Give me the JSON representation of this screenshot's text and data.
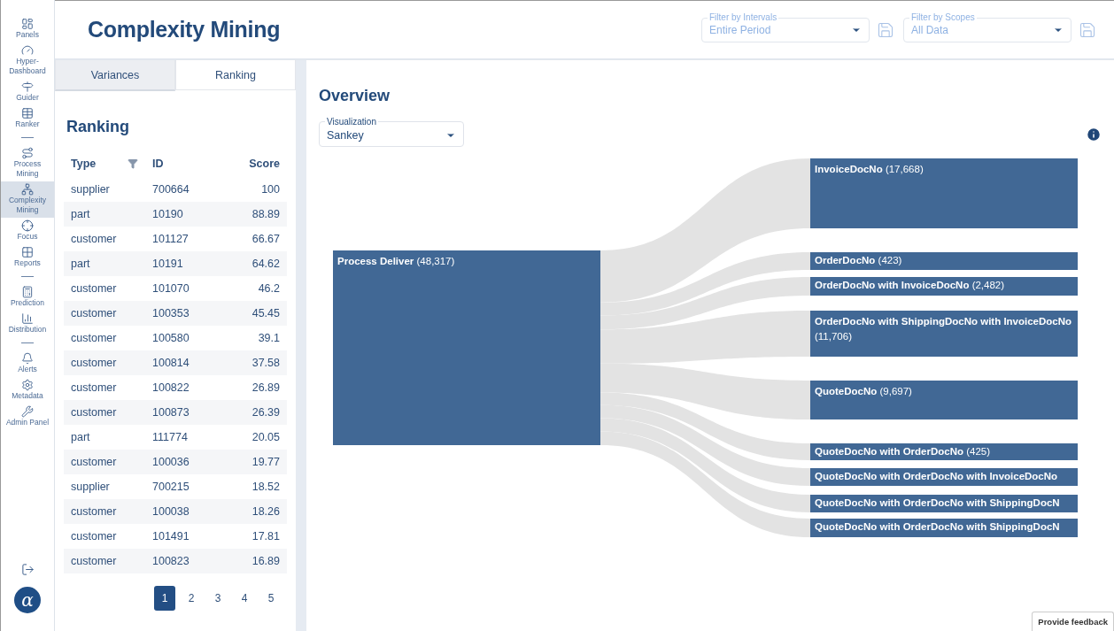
{
  "sidebar": {
    "groups": [
      [
        {
          "label": "Panels",
          "selected": false
        },
        {
          "label": "Hyper-Dashboard",
          "selected": false
        },
        {
          "label": "Guider",
          "selected": false
        },
        {
          "label": "Ranker",
          "selected": false
        }
      ],
      [
        {
          "label": "Process Mining",
          "selected": false
        },
        {
          "label": "Complexity Mining",
          "selected": true
        },
        {
          "label": "Focus",
          "selected": false
        },
        {
          "label": "Reports",
          "selected": false
        }
      ],
      [
        {
          "label": "Prediction",
          "selected": false
        },
        {
          "label": "Distribution",
          "selected": false
        }
      ],
      [
        {
          "label": "Alerts",
          "selected": false
        },
        {
          "label": "Metadata",
          "selected": false
        },
        {
          "label": "Admin Panel",
          "selected": false
        }
      ]
    ],
    "logo": "α"
  },
  "header": {
    "title": "Complexity Mining",
    "filters": [
      {
        "label": "Filter by Intervals",
        "value": "Entire Period"
      },
      {
        "label": "Filter by Scopes",
        "value": "All Data"
      }
    ]
  },
  "tabs": [
    {
      "label": "Variances",
      "selected": false
    },
    {
      "label": "Ranking",
      "selected": true
    }
  ],
  "ranking": {
    "title": "Ranking",
    "columns": [
      "Type",
      "ID",
      "Score"
    ],
    "rows": [
      [
        "supplier",
        "700664",
        "100"
      ],
      [
        "part",
        "10190",
        "88.89"
      ],
      [
        "customer",
        "101127",
        "66.67"
      ],
      [
        "part",
        "10191",
        "64.62"
      ],
      [
        "customer",
        "101070",
        "46.2"
      ],
      [
        "customer",
        "100353",
        "45.45"
      ],
      [
        "customer",
        "100580",
        "39.1"
      ],
      [
        "customer",
        "100814",
        "37.58"
      ],
      [
        "customer",
        "100822",
        "26.89"
      ],
      [
        "customer",
        "100873",
        "26.39"
      ],
      [
        "part",
        "111774",
        "20.05"
      ],
      [
        "customer",
        "100036",
        "19.77"
      ],
      [
        "supplier",
        "700215",
        "18.52"
      ],
      [
        "customer",
        "100038",
        "18.26"
      ],
      [
        "customer",
        "101491",
        "17.81"
      ],
      [
        "customer",
        "100823",
        "16.89"
      ]
    ],
    "pages": [
      {
        "label": "1",
        "selected": true
      },
      {
        "label": "2",
        "selected": false
      },
      {
        "label": "3",
        "selected": false
      },
      {
        "label": "4",
        "selected": false
      },
      {
        "label": "5",
        "selected": false
      }
    ]
  },
  "overview": {
    "title": "Overview",
    "visualization": {
      "label": "Visualization",
      "value": "Sankey"
    },
    "source": "**Process Deliver** (48,317)",
    "targets": [
      "**InvoiceDocNo** (17,668)",
      "**OrderDocNo** (423)",
      "**OrderDocNo with InvoiceDocNo** (2,482)",
      "**OrderDocNo with ShippingDocNo with InvoiceDocNo** (11,706)",
      "**QuoteDocNo** (9,697)",
      "**QuoteDocNo with OrderDocNo** (425)",
      "**QuoteDocNo with OrderDocNo with InvoiceDocNo**",
      "**QuoteDocNo with OrderDocNo with ShippingDocN**",
      "**QuoteDocNo with OrderDocNo with ShippingDocN**"
    ]
  },
  "feedback": "Provide feedback"
}
